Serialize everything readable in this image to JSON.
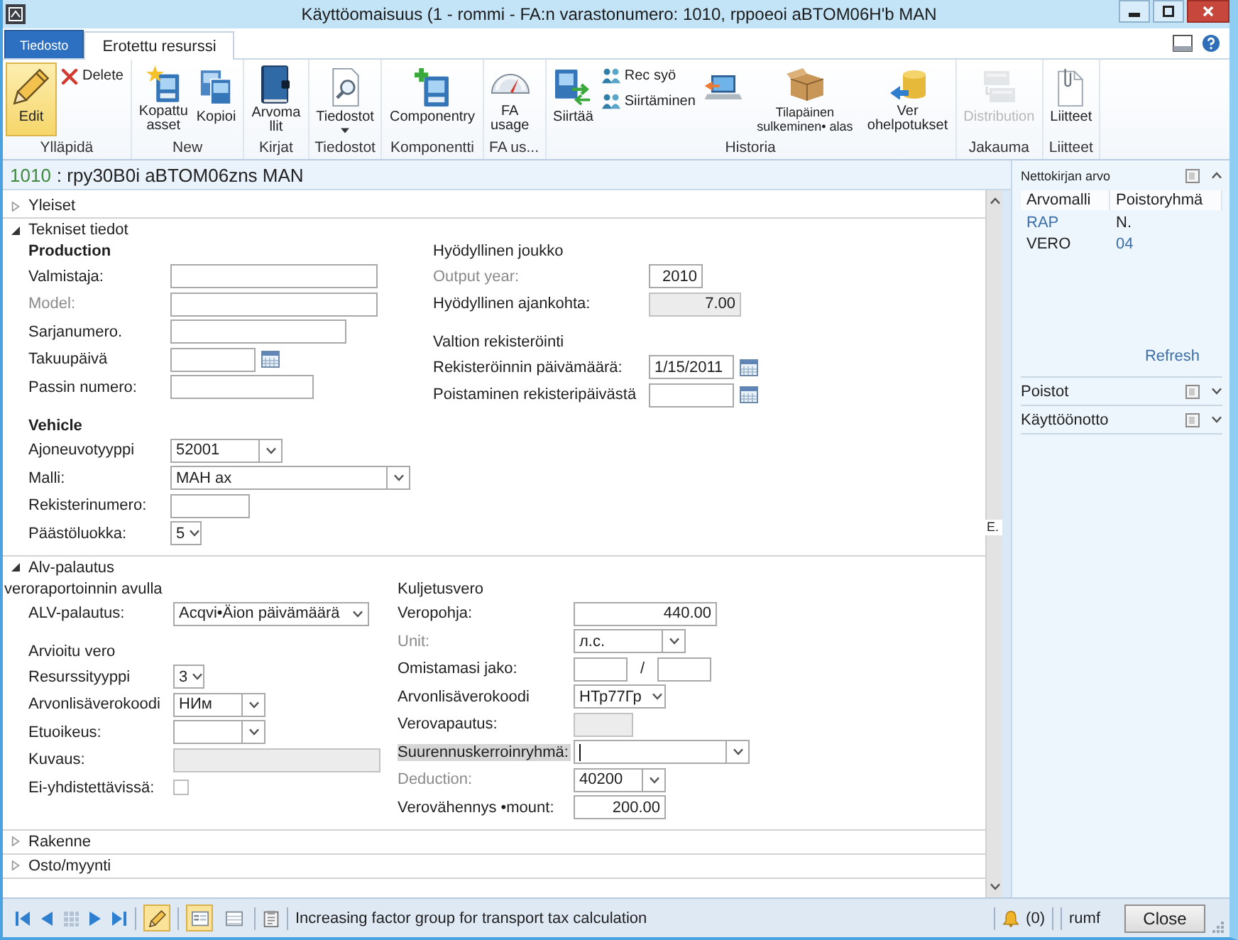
{
  "window": {
    "title": "Käyttöomaisuus (1 - rommi - FA:n varastonumero: 1010, rppoeoi aBTOM06H'b MAN"
  },
  "tabs": [
    {
      "label": "Tiedosto",
      "kind": "file",
      "selected": false
    },
    {
      "label": "Erotettu resurssi",
      "kind": "page",
      "selected": true
    }
  ],
  "ribbon": {
    "groups": [
      {
        "label": "Ylläpidä",
        "buttons": [
          {
            "label": "Edit",
            "kind": "large",
            "selected": true,
            "disabled": false
          },
          {
            "label": "Delete",
            "kind": "small",
            "selected": false,
            "disabled": false
          }
        ]
      },
      {
        "label": "New",
        "buttons": [
          {
            "label": "Kopattu asset",
            "kind": "large",
            "selected": false,
            "disabled": false
          },
          {
            "label": "Kopioi",
            "kind": "large",
            "selected": false,
            "disabled": false
          }
        ]
      },
      {
        "label": "Kirjat",
        "buttons": [
          {
            "label": "Arvoma llit",
            "kind": "large",
            "selected": false,
            "disabled": false
          }
        ]
      },
      {
        "label": "Tiedostot",
        "buttons": [
          {
            "label": "Tiedostot",
            "kind": "menu",
            "selected": false,
            "disabled": false
          }
        ]
      },
      {
        "label": "Komponentti",
        "buttons": [
          {
            "label": "Componentry",
            "kind": "large",
            "selected": false,
            "disabled": false
          }
        ]
      },
      {
        "label": "FA us...",
        "buttons": [
          {
            "label": "FA usage",
            "kind": "large",
            "selected": false,
            "disabled": false
          }
        ]
      },
      {
        "label": "Historia",
        "buttons": [
          {
            "label": "Siirtää",
            "kind": "large",
            "selected": false,
            "disabled": false
          },
          {
            "label": "Rec syö",
            "kind": "small",
            "selected": false,
            "disabled": false
          },
          {
            "label": "Siirtäminen",
            "kind": "small",
            "selected": false,
            "disabled": false
          },
          {
            "kind": "large",
            "selected": false,
            "disabled": false
          },
          {
            "label": "Tilapäinen sulkeminen• alas",
            "kind": "large",
            "selected": false,
            "disabled": false
          },
          {
            "label": "Ver ohelpotukset",
            "kind": "large",
            "selected": false,
            "disabled": false
          }
        ]
      },
      {
        "label": "Jakauma",
        "buttons": [
          {
            "label": "Distribution",
            "kind": "large",
            "selected": false,
            "disabled": true
          }
        ]
      },
      {
        "label": "Liitteet",
        "buttons": [
          {
            "label": "Liitteet",
            "kind": "large",
            "selected": false,
            "disabled": false
          }
        ]
      }
    ]
  },
  "form": {
    "record_id": "1010",
    "record_name": ": rpy30B0i aBTOM06zns MAN",
    "scroll_marker": "E.",
    "sections": [
      {
        "title": "Yleiset",
        "expanded": false
      },
      {
        "title": "Tekniset tiedot",
        "expanded": true,
        "columns": [
          {
            "groups": [
              {
                "title": "Production",
                "kind": "strong",
                "fields": [
                  {
                    "label": "Valmistaja:",
                    "kind": "text",
                    "readonly": false,
                    "focused": false,
                    "muted": false
                  },
                  {
                    "label": "Model:",
                    "kind": "text",
                    "readonly": false,
                    "focused": false,
                    "muted": true
                  },
                  {
                    "label": "Sarjanumero.",
                    "kind": "text",
                    "readonly": false,
                    "focused": false,
                    "muted": false
                  },
                  {
                    "label": "Takuupäivä",
                    "kind": "date",
                    "readonly": false,
                    "focused": false,
                    "muted": false
                  },
                  {
                    "label": "Passin numero:",
                    "kind": "text",
                    "readonly": false,
                    "focused": false,
                    "muted": false
                  }
                ]
              },
              {
                "title": "Vehicle",
                "kind": "strong",
                "fields": [
                  {
                    "label": "Ajoneuvotyyppi",
                    "kind": "combo",
                    "value": "52001",
                    "readonly": false,
                    "focused": false,
                    "muted": false
                  },
                  {
                    "label": "Malli:",
                    "kind": "combo",
                    "value": "МАН ах",
                    "readonly": false,
                    "focused": false,
                    "muted": false
                  },
                  {
                    "label": "Rekisterinumero:",
                    "kind": "text",
                    "readonly": false,
                    "focused": false,
                    "muted": false
                  },
                  {
                    "label": "Päästöluokka:",
                    "kind": "combo",
                    "value": "5",
                    "readonly": false,
                    "focused": false,
                    "muted": false
                  }
                ]
              }
            ]
          },
          {
            "groups": [
              {
                "title": "Hyödyllinen joukko",
                "kind": "plain",
                "fields": [
                  {
                    "label": "Output year:",
                    "kind": "number",
                    "value": "2010",
                    "readonly": false,
                    "focused": false,
                    "muted": true
                  },
                  {
                    "label": "Hyödyllinen ajankohta:",
                    "kind": "number",
                    "value": "7.00",
                    "readonly": true,
                    "focused": false,
                    "muted": false
                  }
                ]
              },
              {
                "title": "Valtion rekisteröinti",
                "kind": "plain",
                "fields": [
                  {
                    "label": "Rekisteröinnin päivämäärä:",
                    "kind": "date",
                    "value": "1/15/2011",
                    "readonly": false,
                    "focused": false,
                    "muted": false
                  },
                  {
                    "label": "Poistaminen rekisteripäivästä",
                    "kind": "date",
                    "readonly": false,
                    "focused": false,
                    "muted": false
                  }
                ]
              }
            ]
          }
        ]
      },
      {
        "title": "Alv-palautus",
        "expanded": true,
        "columns": [
          {
            "groups": [
              {
                "title": "veroraportoinnin avulla",
                "kind": "flush",
                "fields": [
                  {
                    "label": "ALV-palautus:",
                    "kind": "combo",
                    "value": "Acqvi•Äion päivämäärä",
                    "readonly": false,
                    "focused": false,
                    "muted": false
                  }
                ]
              },
              {
                "title": "Arvioitu vero",
                "kind": "plain",
                "fields": [
                  {
                    "label": "Resurssityyppi",
                    "kind": "combo",
                    "value": "3",
                    "readonly": false,
                    "focused": false,
                    "muted": false
                  },
                  {
                    "label": "Arvonlisäverokoodi",
                    "kind": "combo",
                    "value": "НИм",
                    "readonly": false,
                    "focused": false,
                    "muted": false
                  },
                  {
                    "label": "Etuoikeus:",
                    "kind": "combo",
                    "readonly": false,
                    "focused": false,
                    "muted": false
                  },
                  {
                    "label": "Kuvaus:",
                    "kind": "text",
                    "readonly": true,
                    "focused": false,
                    "muted": false
                  },
                  {
                    "label": "Ei-yhdistettävissä:",
                    "kind": "check",
                    "checked": false,
                    "readonly": false,
                    "focused": false,
                    "muted": false
                  }
                ]
              }
            ]
          },
          {
            "groups": [
              {
                "title": "Kuljetusvero",
                "kind": "plain",
                "fields": [
                  {
                    "label": "Veropohja:",
                    "kind": "number",
                    "value": "440.00",
                    "readonly": false,
                    "focused": false,
                    "muted": false
                  },
                  {
                    "label": "Unit:",
                    "kind": "combo",
                    "value": "л.с.",
                    "readonly": false,
                    "focused": false,
                    "muted": true
                  },
                  {
                    "label": "Omistamasi jako:",
                    "kind": "ratio",
                    "separator": "/",
                    "readonly": false,
                    "focused": false,
                    "muted": false
                  },
                  {
                    "label": "Arvonlisäverokoodi",
                    "kind": "combo",
                    "value": "НТр77Гр",
                    "readonly": false,
                    "focused": false,
                    "muted": false
                  },
                  {
                    "label": "Verovapautus:",
                    "kind": "text",
                    "readonly": true,
                    "focused": false,
                    "muted": false
                  },
                  {
                    "label": "Suurennuskerroinryhmä:",
                    "kind": "combo",
                    "readonly": false,
                    "focused": true,
                    "muted": false
                  },
                  {
                    "label": "Deduction:",
                    "kind": "combo",
                    "value": "40200",
                    "readonly": false,
                    "focused": false,
                    "muted": true
                  },
                  {
                    "label": "Verovähennys •mount:",
                    "kind": "number",
                    "value": "200.00",
                    "readonly": false,
                    "focused": false,
                    "muted": false
                  }
                ]
              }
            ]
          }
        ]
      },
      {
        "title": "Rakenne",
        "expanded": false
      },
      {
        "title": "Osto/myynti",
        "expanded": false
      }
    ]
  },
  "factbox": {
    "panels": [
      {
        "title": "Nettokirjan arvo",
        "expanded": true,
        "columns": [
          "Arvomalli",
          "Poistoryhmä"
        ],
        "rows": [
          {
            "cells": [
              {
                "text": "RAP",
                "kind": "link"
              },
              {
                "text": "N.",
                "kind": "text"
              }
            ]
          },
          {
            "cells": [
              {
                "text": "VERO",
                "kind": "text"
              },
              {
                "text": "04",
                "kind": "link"
              }
            ]
          }
        ],
        "action": "Refresh"
      },
      {
        "title": "Poistot",
        "expanded": false
      },
      {
        "title": "Käyttöönotto",
        "expanded": false
      }
    ]
  },
  "status_bar": {
    "edit_mode": true,
    "views": [
      {
        "selected": true
      },
      {
        "selected": false
      }
    ],
    "message": "Increasing factor group for transport tax calculation",
    "notifications": "(0)",
    "company": "rumf",
    "close": "Close"
  }
}
